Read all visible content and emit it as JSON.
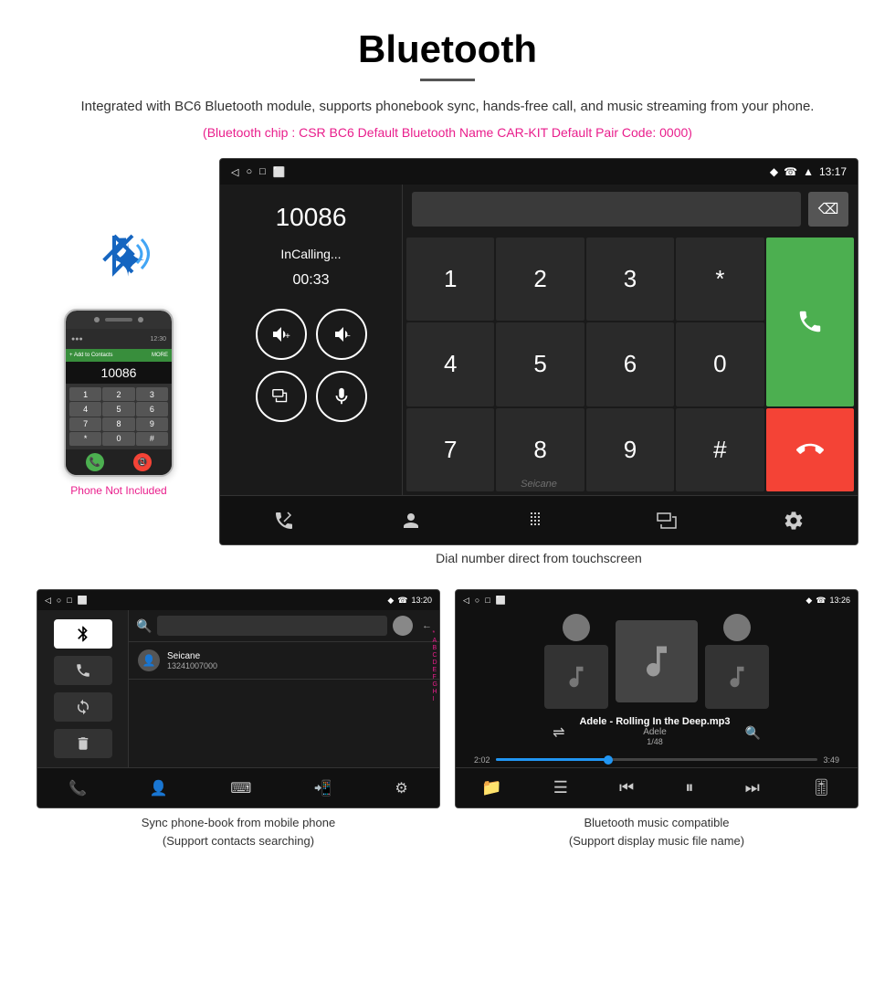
{
  "header": {
    "title": "Bluetooth",
    "description": "Integrated with BC6 Bluetooth module, supports phonebook sync, hands-free call, and music streaming from your phone.",
    "specs": "(Bluetooth chip : CSR BC6    Default Bluetooth Name CAR-KIT    Default Pair Code: 0000)"
  },
  "phone_side": {
    "label": "Phone Not Included",
    "dialpad_keys": [
      "1",
      "2",
      "3",
      "4",
      "5",
      "6",
      "7",
      "8",
      "9",
      "*",
      "0",
      "#"
    ]
  },
  "main_screen": {
    "status_bar": {
      "nav_icons": [
        "◁",
        "○",
        "□",
        "⬜"
      ],
      "right_icons": "♦ ☎ ▲ 13:17"
    },
    "call": {
      "number": "10086",
      "status": "InCalling...",
      "timer": "00:33"
    },
    "dialpad_keys": [
      "1",
      "2",
      "3",
      "*",
      "4",
      "5",
      "6",
      "0",
      "7",
      "8",
      "9",
      "#"
    ],
    "caption": "Dial number direct from touchscreen"
  },
  "phonebook_screen": {
    "status_time": "13:20",
    "contact_name": "Seicane",
    "contact_number": "13241007000",
    "alpha_list": [
      "*",
      "A",
      "B",
      "C",
      "D",
      "E",
      "F",
      "G",
      "H",
      "I"
    ],
    "caption_line1": "Sync phone-book from mobile phone",
    "caption_line2": "(Support contacts searching)"
  },
  "music_screen": {
    "status_time": "13:26",
    "song_title": "Adele - Rolling In the Deep.mp3",
    "artist": "Adele",
    "track": "1/48",
    "time_current": "2:02",
    "time_total": "3:49",
    "caption_line1": "Bluetooth music compatible",
    "caption_line2": "(Support display music file name)"
  }
}
